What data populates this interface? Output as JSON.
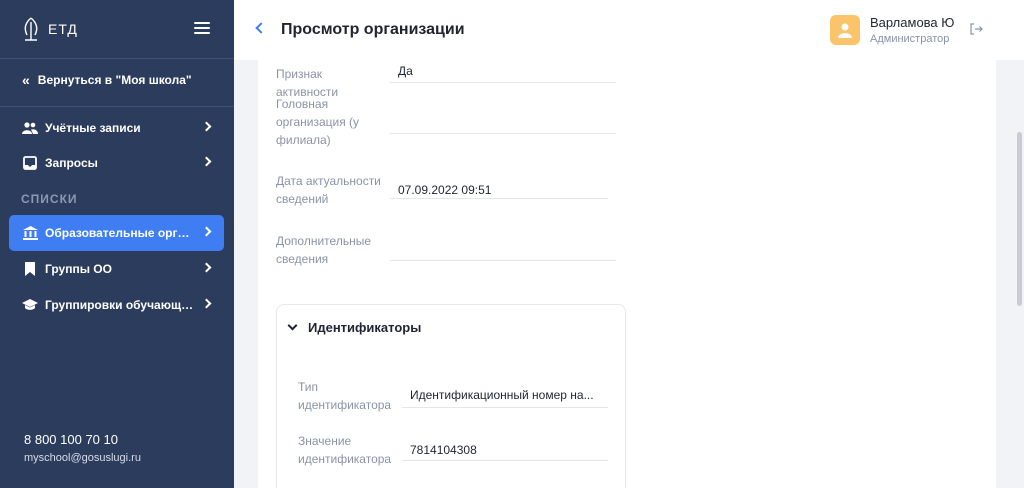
{
  "app": {
    "brand": "ЕТД"
  },
  "sidebar": {
    "back_label": "Вернуться в \"Моя школа\"",
    "items_top": [
      {
        "label": "Учётные записи",
        "icon": "users-icon"
      },
      {
        "label": "Запросы",
        "icon": "inbox-icon"
      }
    ],
    "section_label": "СПИСКИ",
    "items_lists": [
      {
        "label": "Образовательные организации",
        "icon": "institution-icon",
        "active": true
      },
      {
        "label": "Группы ОО",
        "icon": "bookmark-icon"
      },
      {
        "label": "Группировки обучающихся",
        "icon": "graduation-cap-icon"
      }
    ],
    "phone": "8 800 100 70 10",
    "email": "myschool@gosuslugi.ru"
  },
  "header": {
    "title": "Просмотр организации",
    "user_name": "Варламова Ю",
    "user_role": "Администратор"
  },
  "fields": [
    {
      "label": "Признак активности",
      "value": "Да"
    },
    {
      "label": "Головная организация (у филиала)",
      "value": ""
    },
    {
      "label": "Дата актуальности сведений",
      "value": "07.09.2022 09:51"
    },
    {
      "label": "Дополнительные сведения",
      "value": ""
    }
  ],
  "identifiers": {
    "title": "Идентификаторы",
    "fields": [
      {
        "label": "Тип идентификатора",
        "value": "Идентификационный номер на..."
      },
      {
        "label": "Значение идентификатора",
        "value": "7814104308"
      }
    ]
  },
  "colors": {
    "sidebar": "#2c3c5c",
    "accent": "#3f7ef2",
    "avatar": "#fbc46a"
  }
}
